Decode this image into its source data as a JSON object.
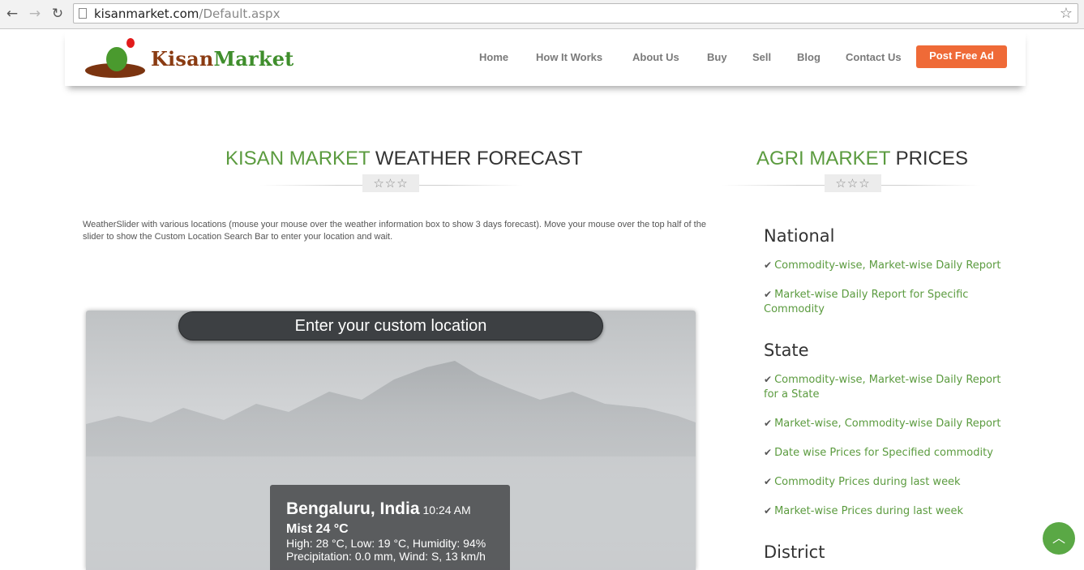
{
  "browser": {
    "back": "←",
    "forward": "→",
    "reload": "↻",
    "url_host": "kisanmarket.com",
    "url_path": "/Default.aspx",
    "bookmark": "☆"
  },
  "header": {
    "logo_first": "Kisan",
    "logo_second": "Market",
    "menu": [
      "Home",
      "How It Works",
      "About Us",
      "Buy",
      "Sell",
      "Blog",
      "Contact Us"
    ],
    "post_ad": "Post Free Ad"
  },
  "weather_section": {
    "title_green": "KISAN MARKET",
    "title_dark": " WEATHER FORECAST",
    "stars": "☆☆☆",
    "intro": "WeatherSlider with various locations (mouse your mouse over the weather information box to show 3 days forecast). Move your mouse over the top half of the slider to show the Custom Location Search Bar to enter your location and wait.",
    "search_placeholder": "Enter your custom location",
    "city": "Bengaluru, India",
    "time": "10:24 AM",
    "condition": "Mist 24 °C",
    "details_1": "High: 28 °C, Low: 19 °C, Humidity: 94%",
    "details_2": "Precipitation: 0.0 mm, Wind: S, 13 km/h"
  },
  "agri_section": {
    "title_green": "AGRI MARKET",
    "title_dark": " PRICES",
    "stars": "☆☆☆",
    "national_heading": "National",
    "national_links": [
      "Commodity-wise, Market-wise Daily Report",
      "Market-wise Daily Report for Specific Commodity"
    ],
    "state_heading": "State",
    "state_links": [
      "Commodity-wise, Market-wise Daily Report for a State",
      "Market-wise, Commodity-wise Daily Report",
      "Date wise Prices for Specified commodity",
      "Commodity Prices during last week",
      "Market-wise Prices during last week"
    ],
    "district_heading": "District",
    "check_mark": "✔"
  },
  "scroll_top": "︿"
}
